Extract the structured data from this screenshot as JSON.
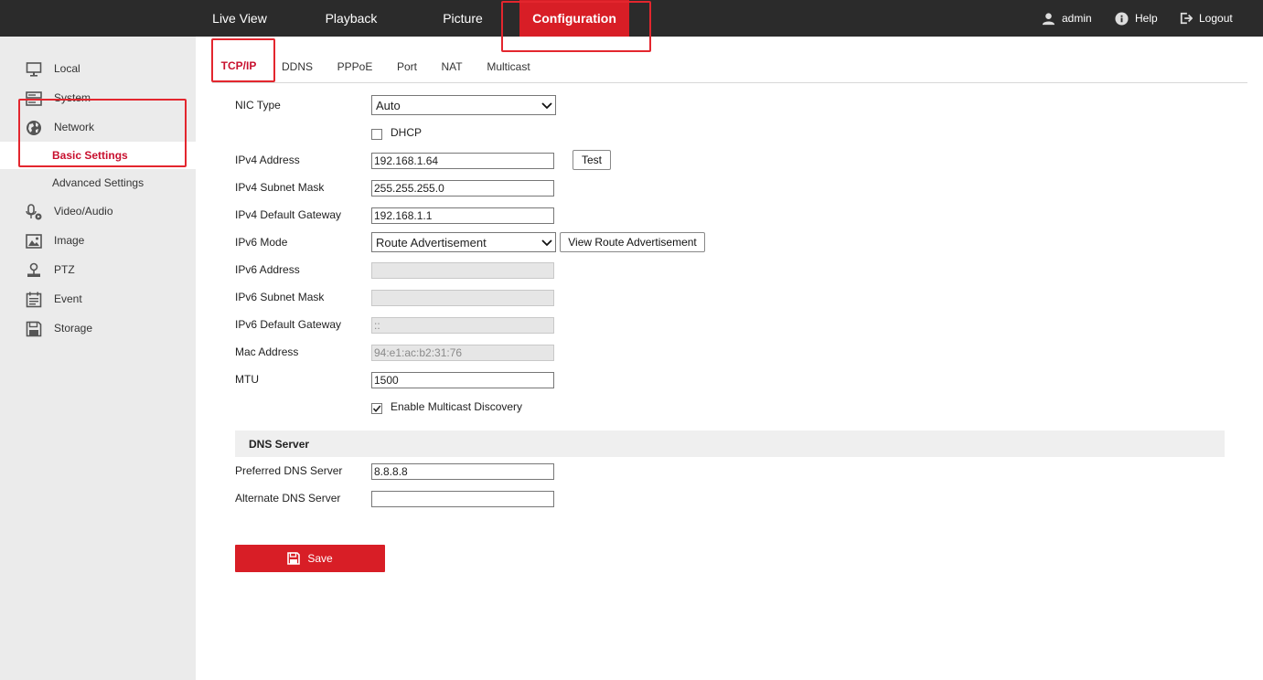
{
  "topnav": {
    "items": [
      {
        "label": "Live View"
      },
      {
        "label": "Playback"
      },
      {
        "label": "Picture"
      },
      {
        "label": "Configuration"
      }
    ],
    "user": "admin",
    "help": "Help",
    "logout": "Logout"
  },
  "sidebar": {
    "items": [
      {
        "label": "Local",
        "icon": "monitor-icon"
      },
      {
        "label": "System",
        "icon": "server-icon"
      },
      {
        "label": "Network",
        "icon": "globe-icon"
      },
      {
        "label": "Video/Audio",
        "icon": "microphone-icon"
      },
      {
        "label": "Image",
        "icon": "image-icon"
      },
      {
        "label": "PTZ",
        "icon": "ptz-icon"
      },
      {
        "label": "Event",
        "icon": "event-icon"
      },
      {
        "label": "Storage",
        "icon": "storage-icon"
      }
    ],
    "network_sub": [
      {
        "label": "Basic Settings"
      },
      {
        "label": "Advanced Settings"
      }
    ]
  },
  "tabs": [
    {
      "label": "TCP/IP"
    },
    {
      "label": "DDNS"
    },
    {
      "label": "PPPoE"
    },
    {
      "label": "Port"
    },
    {
      "label": "NAT"
    },
    {
      "label": "Multicast"
    }
  ],
  "form": {
    "nic_type": {
      "label": "NIC Type",
      "value": "Auto"
    },
    "dhcp": {
      "label": "DHCP",
      "checked": false
    },
    "ipv4_address": {
      "label": "IPv4 Address",
      "value": "192.168.1.64",
      "test": "Test"
    },
    "ipv4_mask": {
      "label": "IPv4 Subnet Mask",
      "value": "255.255.255.0"
    },
    "ipv4_gateway": {
      "label": "IPv4 Default Gateway",
      "value": "192.168.1.1"
    },
    "ipv6_mode": {
      "label": "IPv6 Mode",
      "value": "Route Advertisement",
      "view_button": "View Route Advertisement"
    },
    "ipv6_address": {
      "label": "IPv6 Address",
      "value": ""
    },
    "ipv6_mask": {
      "label": "IPv6 Subnet Mask",
      "value": ""
    },
    "ipv6_gateway": {
      "label": "IPv6 Default Gateway",
      "value": "::"
    },
    "mac": {
      "label": "Mac Address",
      "value": "94:e1:ac:b2:31:76"
    },
    "mtu": {
      "label": "MTU",
      "value": "1500"
    },
    "multicast_discovery": {
      "label": "Enable Multicast Discovery",
      "checked": true
    }
  },
  "dns": {
    "title": "DNS Server",
    "preferred": {
      "label": "Preferred DNS Server",
      "value": "8.8.8.8"
    },
    "alternate": {
      "label": "Alternate DNS Server",
      "value": ""
    }
  },
  "save_label": "Save",
  "colors": {
    "accent": "#d81e26",
    "topbar": "#2b2b2b",
    "sidebar": "#ebebeb"
  }
}
